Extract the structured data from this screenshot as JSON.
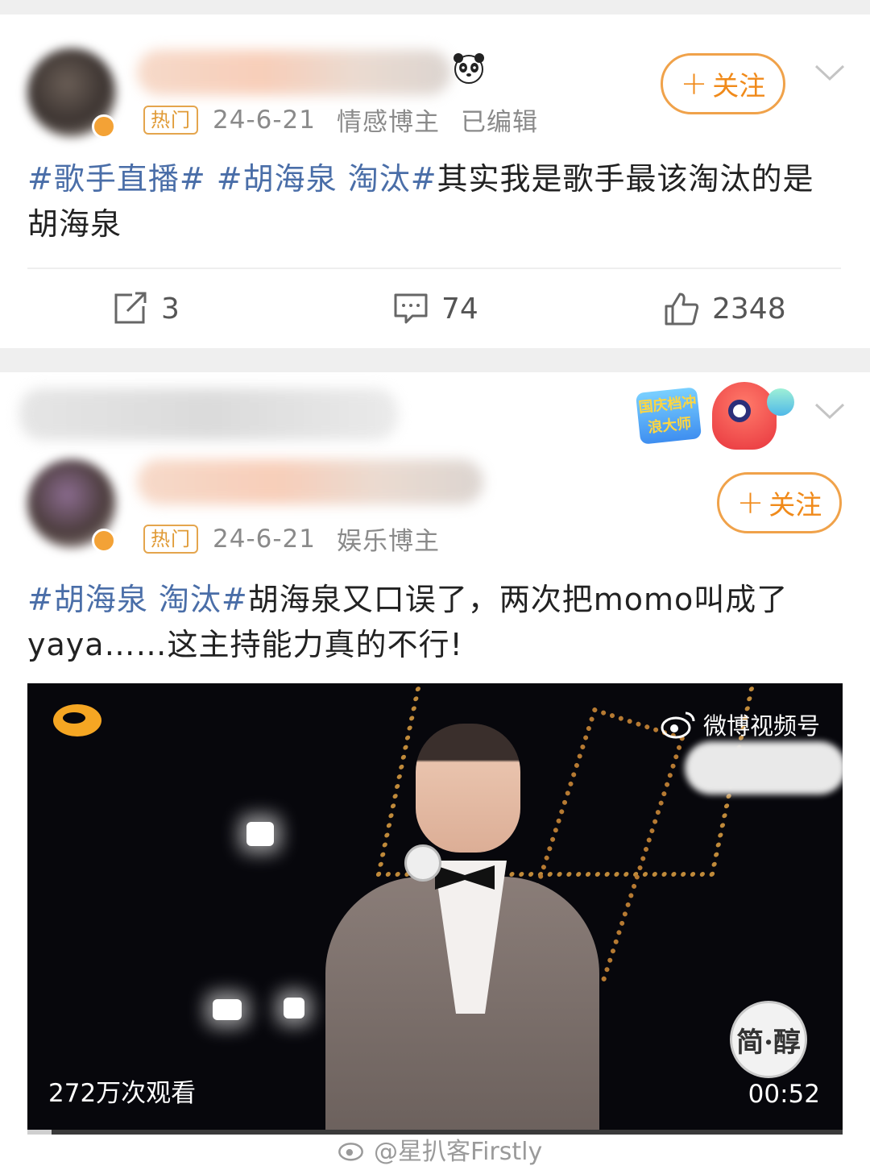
{
  "colors": {
    "accent_orange": "#f08a1a",
    "topic_blue": "#4a6ea8",
    "hot_tag": "#e09a35",
    "meta_gray": "#8a8a8a"
  },
  "post1": {
    "hot_label": "热门",
    "date": "24-6-21",
    "role": "情感博主",
    "edited": "已编辑",
    "follow_label": "关注",
    "tag1": "#歌手直播#",
    "tag2": "#胡海泉 淘汰#",
    "text": "其实我是歌手最该淘汰的是胡海泉",
    "repost_count": "3",
    "comment_count": "74",
    "like_count": "2348"
  },
  "post2": {
    "hot_label": "热门",
    "date": "24-6-21",
    "role": "娱乐博主",
    "follow_label": "关注",
    "badge_text": "国庆档冲浪大师",
    "tag1": "#胡海泉 淘汰#",
    "text": "胡海泉又口误了，两次把momo叫成了yaya……这主持能力真的不行!",
    "video": {
      "channel_label": "微博视频号",
      "views": "272万次观看",
      "duration": "00:52",
      "sponsor": "简·醇",
      "progress": 0.03
    }
  },
  "footer_watermark": "@星扒客Firstly"
}
